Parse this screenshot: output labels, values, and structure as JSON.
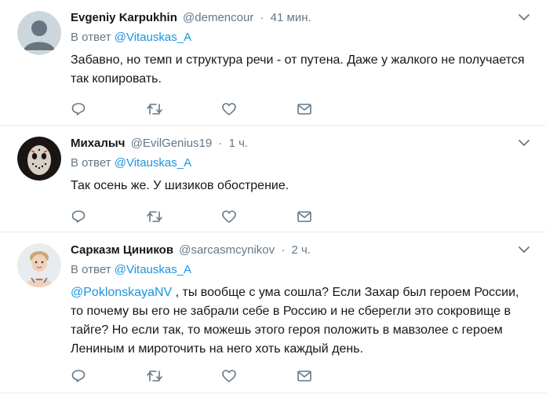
{
  "tweets": [
    {
      "fullname": "Evgeniy Karpukhin",
      "username": "@demencour",
      "separator": "·",
      "time": "41 мин.",
      "reply_prefix": "В ответ",
      "reply_handle": "@Vitauskas_A",
      "text": "Забавно, но темп и структура речи - от путена. Даже у жалкого не получается так копировать.",
      "avatar_icon": "default-avatar-icon"
    },
    {
      "fullname": "Михалыч",
      "username": "@EvilGenius19",
      "separator": "·",
      "time": "1 ч.",
      "reply_prefix": "В ответ",
      "reply_handle": "@Vitauskas_A",
      "text": "Так осень же. У шизиков обострение.",
      "avatar_icon": "hockey-mask-avatar-icon"
    },
    {
      "fullname": "Сарказм Циников",
      "username": "@sarcasmcynikov",
      "separator": "·",
      "time": "2 ч.",
      "reply_prefix": "В ответ",
      "reply_handle": "@Vitauskas_A",
      "mention": "@PoklonskayaNV",
      "text": " , ты вообще с ума сошла? Если Захар был героем России, то почему вы его не забрали себе в Россию и не сберегли это сокровище в тайге? Но если так, то можешь этого героя положить в мавзолее с героем Лениным и мироточить на него хоть каждый день.",
      "avatar_icon": "child-photo-avatar-icon"
    }
  ],
  "colors": {
    "link": "#1b95e0",
    "muted": "#657786",
    "text": "#14171a",
    "divider": "#e6ecf0"
  },
  "icons": [
    "reply-icon",
    "retweet-icon",
    "like-icon",
    "direct-message-icon",
    "chevron-down-icon"
  ]
}
